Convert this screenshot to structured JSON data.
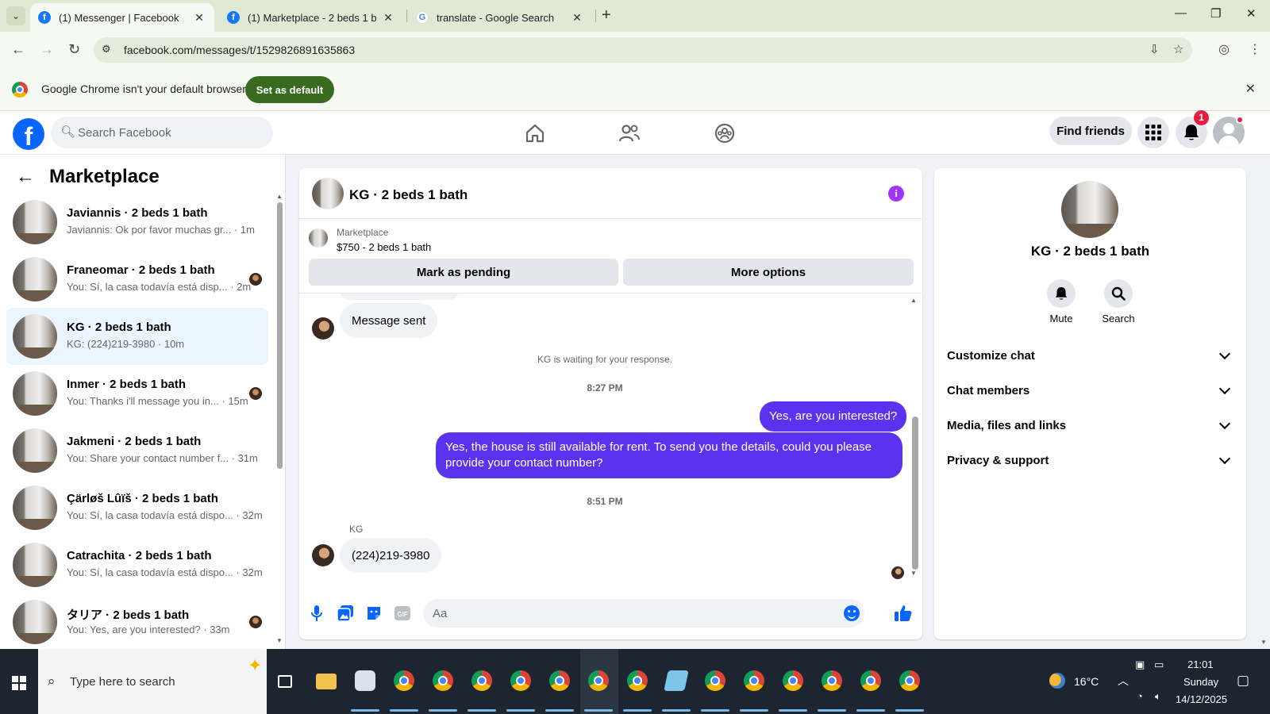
{
  "browser": {
    "tabs": [
      {
        "title": "(1) Messenger | Facebook",
        "favicon": "facebook-icon",
        "active": true
      },
      {
        "title": "(1) Marketplace - 2 beds 1 bath",
        "favicon": "facebook-icon",
        "active": false
      },
      {
        "title": "translate - Google Search",
        "favicon": "google-icon",
        "active": false
      }
    ],
    "url": "facebook.com/messages/t/1529826891635863",
    "infobar": {
      "message": "Google Chrome isn't your default browser",
      "button": "Set as default"
    }
  },
  "fb_header": {
    "search_placeholder": "Search Facebook",
    "find_friends": "Find friends",
    "notification_count": "1"
  },
  "sidebar": {
    "title": "Marketplace",
    "conversations": [
      {
        "name": "Javiannis · 2 beds 1 bath",
        "snippet": "Javiannis: Ok por favor muchas gr... · 1m",
        "seen": false
      },
      {
        "name": "Franeomar · 2 beds 1 bath",
        "snippet": "You: Sí, la casa todavía está disp... · 2m",
        "seen": true
      },
      {
        "name": "KG · 2 beds 1 bath",
        "snippet": "KG: (224)219-3980 · 10m",
        "seen": false,
        "active": true
      },
      {
        "name": "Inmer · 2 beds 1 bath",
        "snippet": "You: Thanks i'll message you in... · 15m",
        "seen": true
      },
      {
        "name": "Jakmeni · 2 beds 1 bath",
        "snippet": "You: Share your contact number f... · 31m",
        "seen": false
      },
      {
        "name": "Çärløš Lûïš · 2 beds 1 bath",
        "snippet": "You: Sí, la casa todavía está dispo... · 32m",
        "seen": false
      },
      {
        "name": "Catrachita · 2 beds 1 bath",
        "snippet": "You: Sí, la casa todavía está dispo... · 32m",
        "seen": false
      },
      {
        "name": "タリア · 2 beds 1 bath",
        "snippet": "You: Yes, are you interested? · 33m",
        "seen": true
      }
    ]
  },
  "chat": {
    "title": "KG · 2 beds 1 bath",
    "marketplace_label": "Marketplace",
    "listing": "$750 - 2 beds 1 bath",
    "mark_pending": "Mark as pending",
    "more_options": "More options",
    "msg_sent": "Message sent",
    "waiting": "KG is waiting for your response.",
    "time1": "8:27 PM",
    "out1": "Yes, are you interested?",
    "out2": "Yes, the house is still available for rent. To send you the details, could you please provide your contact number?",
    "time2": "8:51 PM",
    "sender": "KG",
    "in_phone": "(224)219-3980",
    "composer_placeholder": "Aa"
  },
  "details": {
    "name": "KG · 2 beds 1 bath",
    "mute": "Mute",
    "search": "Search",
    "sections": [
      "Customize chat",
      "Chat members",
      "Media, files and links",
      "Privacy & support"
    ]
  },
  "taskbar": {
    "search_placeholder": "Type here to search",
    "temperature": "16°C",
    "time": "21:01",
    "day": "Sunday",
    "date": "14/12/2025"
  },
  "colors": {
    "fb_blue": "#0866ff",
    "outgoing_bubble": "#5b33ee",
    "info_purple": "#a033ff",
    "set_default_green": "#386a20"
  }
}
